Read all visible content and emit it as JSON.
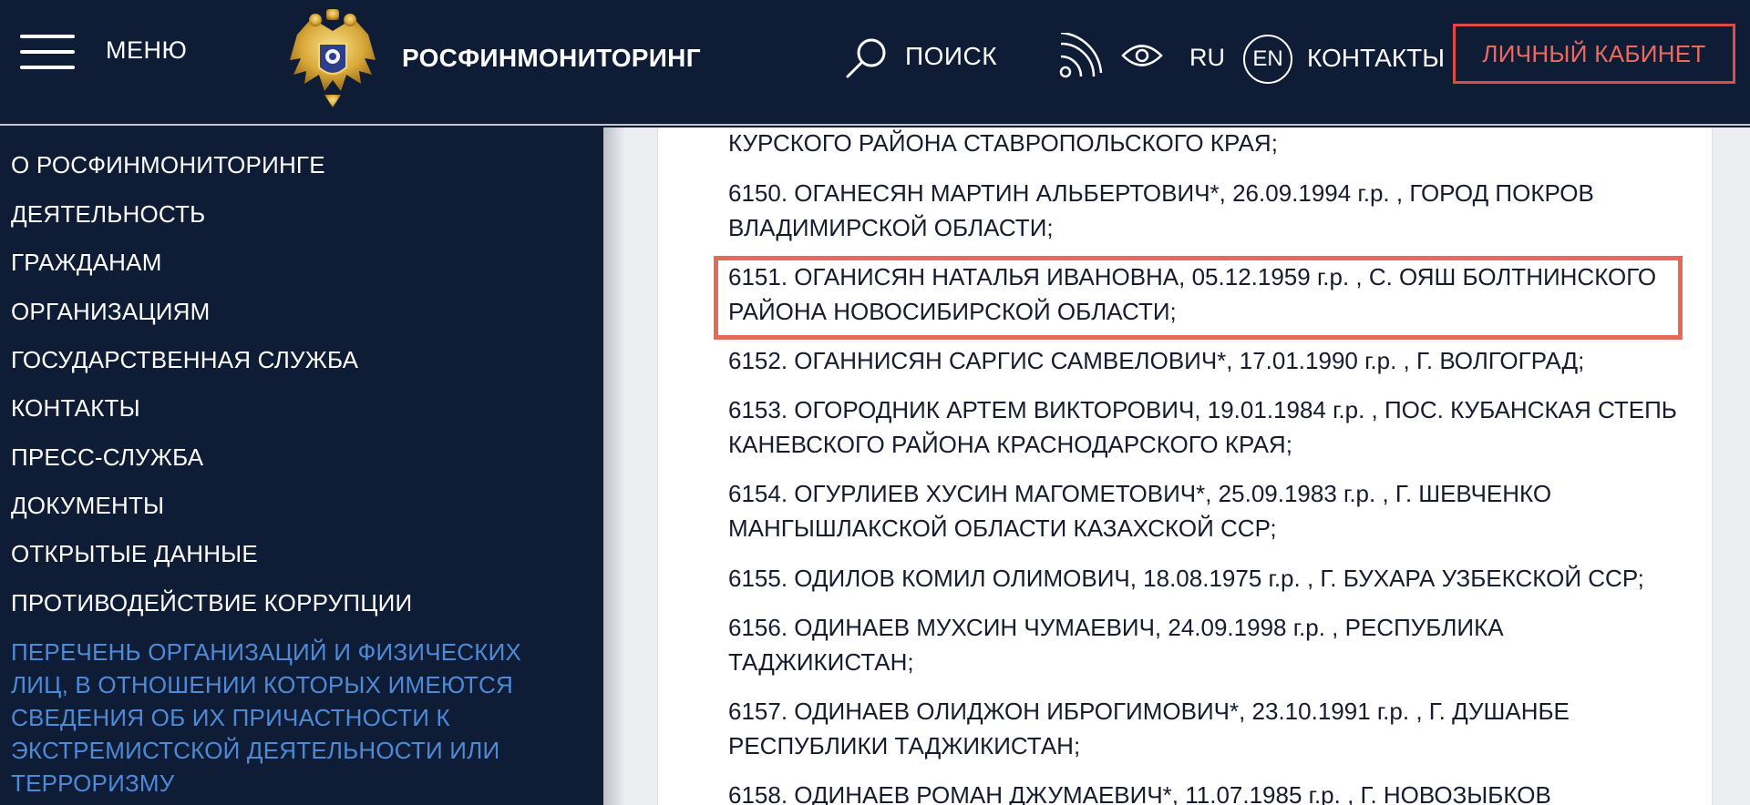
{
  "header": {
    "menu_label": "МЕНЮ",
    "brand": "РОСФИНМОНИТОРИНГ",
    "search_label": "ПОИСК",
    "lang_ru": "RU",
    "lang_en": "EN",
    "contacts": "КОНТАКТЫ",
    "cabinet_button": "ЛИЧНЫЙ КАБИНЕТ"
  },
  "sidebar": {
    "items": [
      "О РОСФИНМОНИТОРИНГЕ",
      "ДЕЯТЕЛЬНОСТЬ",
      "ГРАЖДАНАМ",
      "ОРГАНИЗАЦИЯМ",
      "ГОСУДАРСТВЕННАЯ СЛУЖБА",
      "КОНТАКТЫ",
      "ПРЕСС-СЛУЖБА",
      "ДОКУМЕНТЫ",
      "ОТКРЫТЫЕ ДАННЫЕ",
      "ПРОТИВОДЕЙСТВИЕ КОРРУПЦИИ"
    ],
    "active_item": "ПЕРЕЧЕНЬ ОРГАНИЗАЦИЙ И ФИЗИЧЕСКИХ ЛИЦ, В ОТНОШЕНИИ КОТОРЫХ ИМЕЮТСЯ СВЕДЕНИЯ ОБ ИХ ПРИЧАСТНОСТИ К ЭКСТРЕМИСТСКОЙ ДЕЯТЕЛЬНОСТИ ИЛИ ТЕРРОРИЗМУ"
  },
  "entries": [
    "КУРСКОГО РАЙОНА СТАВРОПОЛЬСКОГО КРАЯ;",
    "6150. ОГАНЕСЯН МАРТИН АЛЬБЕРТОВИЧ*, 26.09.1994 г.р. , ГОРОД ПОКРОВ ВЛАДИМИРСКОЙ ОБЛАСТИ;",
    "6151. ОГАНИСЯН НАТАЛЬЯ ИВАНОВНА, 05.12.1959 г.р. , С. ОЯШ БОЛТНИНСКОГО РАЙОНА НОВОСИБИРСКОЙ ОБЛАСТИ;",
    "6152. ОГАННИСЯН САРГИС САМВЕЛОВИЧ*, 17.01.1990 г.р. , Г. ВОЛГОГРАД;",
    "6153. ОГОРОДНИК АРТЕМ ВИКТОРОВИЧ, 19.01.1984 г.р. , ПОС. КУБАНСКАЯ СТЕПЬ КАНЕВСКОГО РАЙОНА КРАСНОДАРСКОГО КРАЯ;",
    "6154. ОГУРЛИЕВ ХУСИН МАГОМЕТОВИЧ*, 25.09.1983 г.р. , Г. ШЕВЧЕНКО МАНГЫШЛАКСКОЙ ОБЛАСТИ КАЗАХСКОЙ ССР;",
    "6155. ОДИЛОВ КОМИЛ ОЛИМОВИЧ, 18.08.1975 г.р. , Г. БУХАРА УЗБЕКСКОЙ ССР;",
    "6156. ОДИНАЕВ МУХСИН ЧУМАЕВИЧ, 24.09.1998 г.р. , РЕСПУБЛИКА ТАДЖИКИСТАН;",
    "6157. ОДИНАЕВ ОЛИДЖОН ИБРОГИМОВИЧ*, 23.10.1991 г.р. , Г. ДУШАНБЕ РЕСПУБЛИКИ ТАДЖИКИСТАН;",
    "6158. ОДИНАЕВ РОМАН ДЖУМАЕВИЧ*, 11.07.1985 г.р. , Г. НОВОЗЫБКОВ"
  ],
  "highlighted_entry_index": 2,
  "colors": {
    "header_bg": "#0f1c36",
    "accent_red": "#e04b3f",
    "active_link": "#4f8ad6",
    "highlight_border": "#e56a55"
  }
}
